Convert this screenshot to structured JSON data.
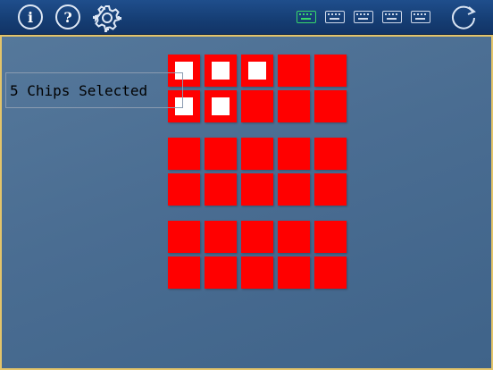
{
  "toolbar": {
    "info_label": "i",
    "help_label": "?",
    "settings_icon": "gear-icon",
    "keyboards": [
      {
        "icon": "keyboard-icon",
        "active": true,
        "color": "#38d76a"
      },
      {
        "icon": "keyboard-icon",
        "active": false
      },
      {
        "icon": "keyboard-icon",
        "active": false
      },
      {
        "icon": "keyboard-icon",
        "active": false
      },
      {
        "icon": "keyboard-icon",
        "active": false
      }
    ],
    "refresh_icon": "refresh-icon"
  },
  "status": {
    "text": "5 Chips Selected"
  },
  "board": {
    "chip_color": "#ff0000",
    "selected_color": "#ffffff",
    "groups": [
      {
        "rows": [
          [
            true,
            true,
            true,
            false,
            false
          ],
          [
            true,
            true,
            false,
            false,
            false
          ]
        ]
      },
      {
        "rows": [
          [
            false,
            false,
            false,
            false,
            false
          ],
          [
            false,
            false,
            false,
            false,
            false
          ]
        ]
      },
      {
        "rows": [
          [
            false,
            false,
            false,
            false,
            false
          ],
          [
            false,
            false,
            false,
            false,
            false
          ]
        ]
      }
    ]
  }
}
